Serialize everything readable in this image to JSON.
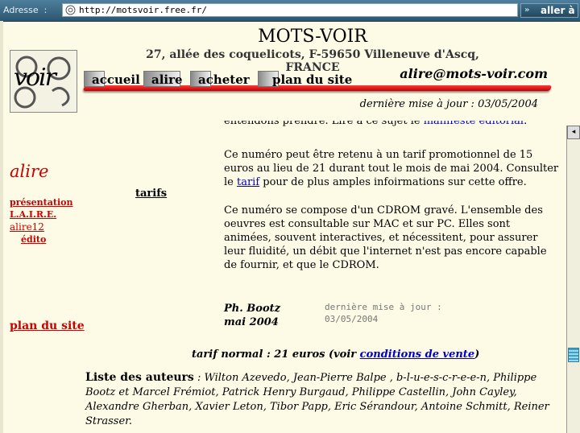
{
  "browser": {
    "address_label": "Adresse",
    "address_sep": ":",
    "url": "http://motsvoir.free.fr/",
    "go_label": "aller à",
    "go_arrow": "»"
  },
  "header": {
    "title": "MOTS-VOIR",
    "address": "27, allée des coquelicots, F-59650 Villeneuve d'Ascq, FRANCE",
    "logo_text": "voir",
    "email": "alire@mots-voir.com",
    "updated": "dernière mise à jour : 03/05/2004",
    "nav": [
      "accueil",
      "alire",
      "acheter",
      "plan du site"
    ]
  },
  "sidebar": {
    "title": "alire",
    "links": [
      "présentation",
      "L.A.I.R.E.",
      "alire12",
      "édito"
    ],
    "plan": "plan du site",
    "tarifs": "tarifs"
  },
  "main": {
    "cut_line_text": "entendons prendre. Lire à ce sujet le ",
    "cut_line_link": "manifeste éditorial",
    "cut_line_end": ".",
    "para1_a": "Ce numéro peut être retenu à un tarif promotionnel de 15 euros au lieu de 21 durant tout le mois de mai 2004. Consulter le ",
    "para1_link": "tarif",
    "para1_b": " pour de plus amples infoirmations sur cette offre.",
    "para2": "Ce numéro se compose d'un CDROM gravé. L'ensemble des oeuvres est consultable sur MAC et sur PC. Elles sont animées, souvent interactives, et nécessitent, pour assurer leur fluidité, un débit que l'internet n'est pas encore capable de fournir, et que le CDROM.",
    "sig_name": "Ph. Bootz",
    "sig_date": "mai 2004",
    "sig_updated_1": "dernière mise à jour :",
    "sig_updated_2": "03/05/2004",
    "tarif_a": "tarif normal : 21 euros (voir ",
    "tarif_link": "conditions de vente",
    "tarif_b": ")",
    "authors_label": "Liste des auteurs",
    "authors": " : Wilton Azevedo, Jean-Pierre Balpe , b-l-u-e-s-c-r-e-e-n, Philippe Bootz et Marcel Frémiot, Patrick Henry Burgaud, Philippe Castellin, John Cayley, Alexandre Gherban, Xavier Leton, Tibor Papp, Eric Sérandour, Antoine Schmitt, Reiner Strasser."
  },
  "scrollbar": {
    "up_arrow": "◂"
  },
  "colors": {
    "accent_red": "#cc0000",
    "link_blue": "#0000cc",
    "background": "#fdfbe6"
  }
}
